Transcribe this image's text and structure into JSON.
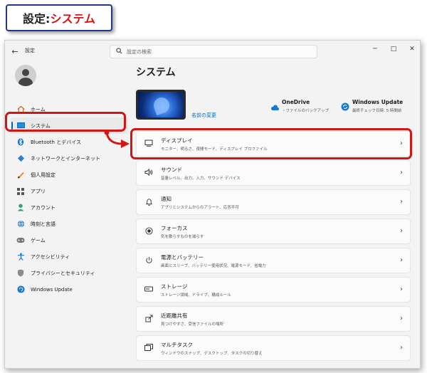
{
  "callout": {
    "prefix": "設定:",
    "highlight": "システム"
  },
  "window": {
    "title": "設定",
    "search_placeholder": "設定の検索",
    "controls": {
      "minimize": "─",
      "maximize": "□",
      "close": "✕"
    }
  },
  "sidebar": {
    "items": [
      {
        "label": "ホーム",
        "icon": "home-icon",
        "active": false
      },
      {
        "label": "システム",
        "icon": "display-icon",
        "active": true
      },
      {
        "label": "Bluetooth とデバイス",
        "icon": "bluetooth-icon",
        "active": false
      },
      {
        "label": "ネットワークとインターネット",
        "icon": "network-icon",
        "active": false
      },
      {
        "label": "個人用設定",
        "icon": "brush-icon",
        "active": false
      },
      {
        "label": "アプリ",
        "icon": "apps-icon",
        "active": false
      },
      {
        "label": "アカウント",
        "icon": "account-icon",
        "active": false
      },
      {
        "label": "時刻と言語",
        "icon": "globe-icon",
        "active": false
      },
      {
        "label": "ゲーム",
        "icon": "gamepad-icon",
        "active": false
      },
      {
        "label": "アクセシビリティ",
        "icon": "accessibility-icon",
        "active": false
      },
      {
        "label": "プライバシーとセキュリティ",
        "icon": "shield-icon",
        "active": false
      },
      {
        "label": "Windows Update",
        "icon": "update-icon",
        "active": false
      }
    ]
  },
  "main": {
    "title": "システム",
    "rename": "名前の変更",
    "onedrive": {
      "title": "OneDrive",
      "sub": "・ファイルのバックアップ"
    },
    "windows_update": {
      "title": "Windows Update",
      "sub": "最終チェック日時: 5 時間前"
    },
    "cards": [
      {
        "title": "ディスプレイ",
        "sub": "モニター、明るさ、夜間モード、ディスプレイ プロファイル",
        "icon": "monitor-icon"
      },
      {
        "title": "サウンド",
        "sub": "音量レベル、出力、入力、サウンド デバイス",
        "icon": "speaker-icon"
      },
      {
        "title": "通知",
        "sub": "アプリとシステムからのアラート、応答不可",
        "icon": "bell-icon"
      },
      {
        "title": "フォーカス",
        "sub": "気を散らすものを減らす",
        "icon": "focus-icon"
      },
      {
        "title": "電源とバッテリー",
        "sub": "画面とスリープ、バッテリー使用状況、電源モード、省電力",
        "icon": "power-icon"
      },
      {
        "title": "ストレージ",
        "sub": "ストレージ領域、ドライブ、構成ルール",
        "icon": "storage-icon"
      },
      {
        "title": "近距離共有",
        "sub": "見つけやすさ、受信ファイルの場所",
        "icon": "share-icon"
      },
      {
        "title": "マルチタスク",
        "sub": "ウィンドウのスナップ、デスクトップ、タスクの切り替え",
        "icon": "multitask-icon"
      }
    ]
  },
  "colors": {
    "accent": "#0067c0",
    "highlight_red": "#d11616",
    "callout_border": "#1f3a8a"
  }
}
